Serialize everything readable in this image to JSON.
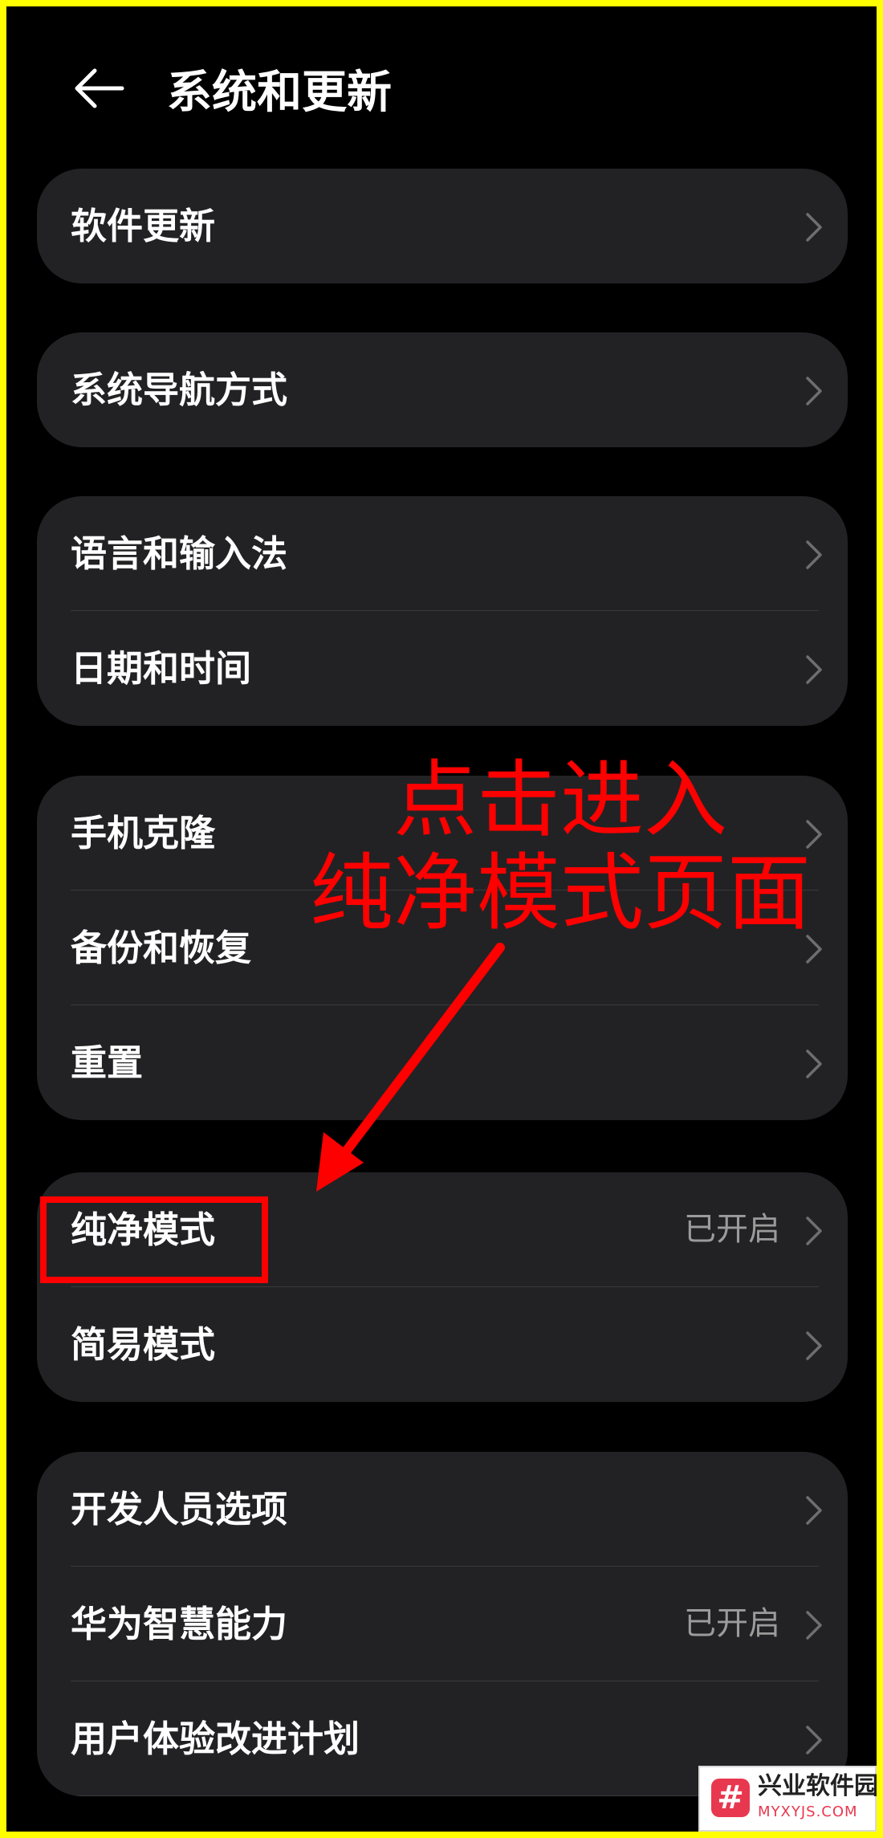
{
  "header": {
    "title": "系统和更新",
    "back_icon": "back-arrow-icon"
  },
  "groups": [
    {
      "items": [
        {
          "label": "软件更新"
        }
      ]
    },
    {
      "items": [
        {
          "label": "系统导航方式"
        }
      ]
    },
    {
      "items": [
        {
          "label": "语言和输入法"
        },
        {
          "label": "日期和时间"
        }
      ]
    },
    {
      "items": [
        {
          "label": "手机克隆"
        },
        {
          "label": "备份和恢复"
        },
        {
          "label": "重置"
        }
      ]
    },
    {
      "items": [
        {
          "label": "纯净模式",
          "status": "已开启"
        },
        {
          "label": "简易模式"
        }
      ]
    },
    {
      "items": [
        {
          "label": "开发人员选项"
        },
        {
          "label": "华为智慧能力",
          "status": "已开启"
        },
        {
          "label": "用户体验改进计划"
        }
      ]
    }
  ],
  "annotation": {
    "line1": "点击进入",
    "line2": "纯净模式页面",
    "color": "#ff0000"
  },
  "watermark": {
    "logo_glyph": "#",
    "name": "兴业软件园",
    "url": "MYXYJS.COM"
  },
  "colors": {
    "background": "#000000",
    "card": "#222224",
    "frame": "#ffff00",
    "secondary_text": "#9b9b9b"
  }
}
